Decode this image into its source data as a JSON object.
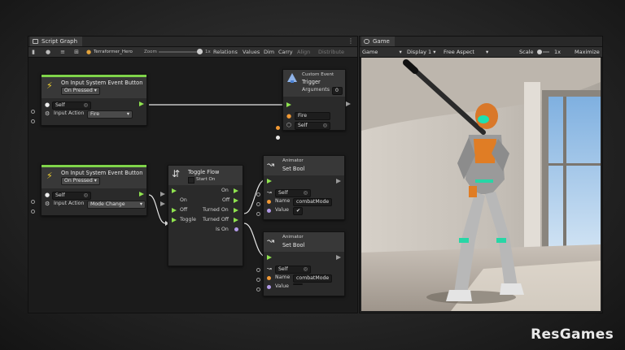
{
  "graph_window": {
    "tab_title": "Script Graph",
    "toolbar": {
      "asset_name": "Terraformer_Hero",
      "zoom_label": "Zoom",
      "zoom_value": "1x",
      "relations": "Relations",
      "values": "Values",
      "dim": "Dim",
      "carry": "Carry",
      "align": "Align",
      "distribute": "Distribute"
    },
    "nodes": {
      "event1": {
        "title": "On Input System Event Button",
        "mode": "On Pressed",
        "self_label": "Self",
        "action_label": "Input Action",
        "action_value": "Fire"
      },
      "trigger": {
        "subtitle": "Custom Event",
        "title": "Trigger",
        "arguments_label": "Arguments",
        "arguments_value": "0",
        "event_name": "Fire",
        "target": "Self"
      },
      "event2": {
        "title": "On Input System Event Button",
        "mode": "On Pressed",
        "self_label": "Self",
        "action_label": "Input Action",
        "action_value": "Mode Change"
      },
      "toggle": {
        "title": "Toggle Flow",
        "start_on": "Start On",
        "in_on": "On",
        "in_off": "Off",
        "in_toggle": "Toggle",
        "out_on": "On",
        "out_off": "Off",
        "out_turned_on": "Turned On",
        "out_turned_off": "Turned Off",
        "out_is_on": "Is On"
      },
      "setbool1": {
        "subtitle": "Animator",
        "title": "Set Bool",
        "target": "Self",
        "name_label": "Name",
        "name_value": "combatMode",
        "value_label": "Value",
        "value_checked": "✔"
      },
      "setbool2": {
        "subtitle": "Animator",
        "title": "Set Bool",
        "target": "Self",
        "name_label": "Name",
        "name_value": "combatMode",
        "value_label": "Value"
      }
    }
  },
  "game_window": {
    "tab_title": "Game",
    "toolbar": {
      "view": "Game",
      "display": "Display 1",
      "aspect": "Free Aspect",
      "scale_label": "Scale",
      "scale_value": "1x",
      "maximize": "Maximize"
    }
  },
  "watermark": "ResGames",
  "colors": {
    "flow": "#8fe24f",
    "event_stripe": "#7fd44a",
    "object_port": "#e8e8e8",
    "string_port": "#f39a35",
    "bool_port": "#b29ae8"
  }
}
